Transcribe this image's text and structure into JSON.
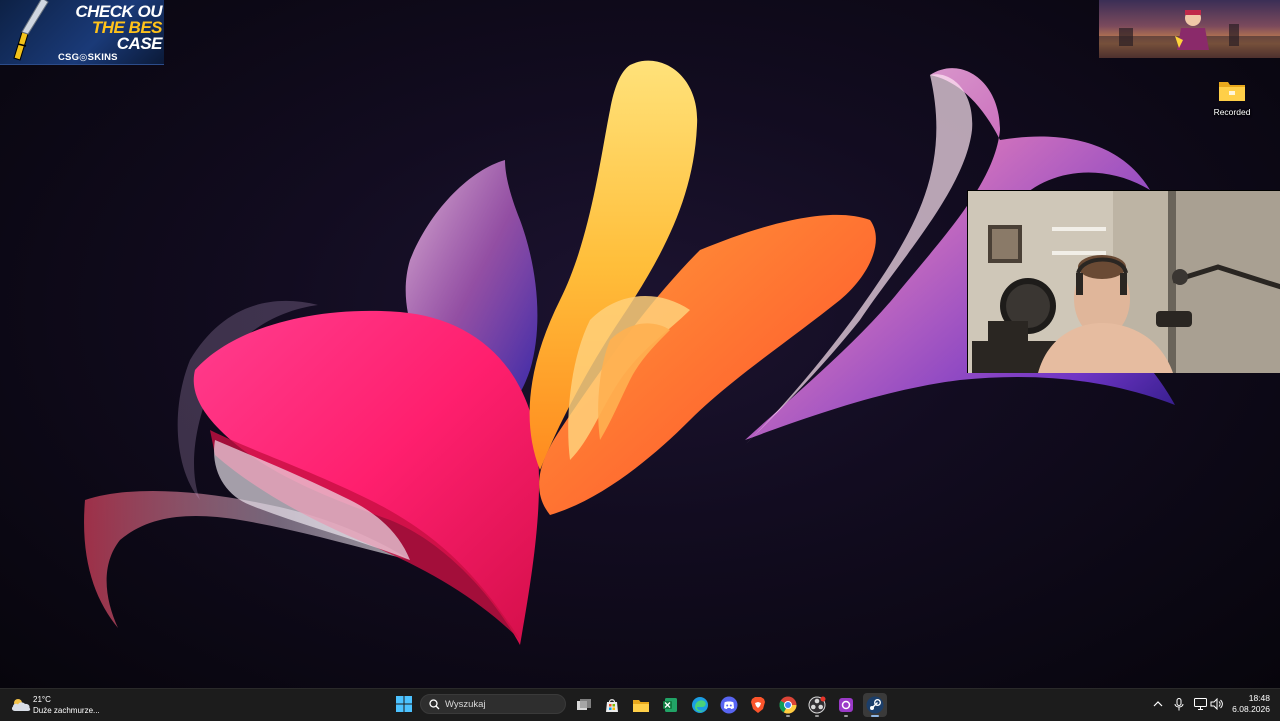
{
  "overlays": {
    "promo": {
      "line1": "CHECK OU",
      "line2": "THE BES",
      "line3": "CASE",
      "brand": "CSG◎SKINS"
    }
  },
  "desktop": {
    "icons": [
      {
        "label": "Recorded",
        "icon": "folder-icon"
      }
    ]
  },
  "taskbar": {
    "weather": {
      "temp": "21°C",
      "description": "Duże zachmurze..."
    },
    "search": {
      "placeholder": "Wyszukaj"
    },
    "apps": [
      {
        "name": "task-view",
        "icon": "task-view-icon"
      },
      {
        "name": "microsoft-store",
        "icon": "store-icon"
      },
      {
        "name": "file-explorer",
        "icon": "folder-icon"
      },
      {
        "name": "excel",
        "icon": "excel-icon"
      },
      {
        "name": "edge",
        "icon": "edge-icon"
      },
      {
        "name": "discord",
        "icon": "discord-icon"
      },
      {
        "name": "brave",
        "icon": "brave-icon"
      },
      {
        "name": "chrome",
        "icon": "chrome-icon"
      },
      {
        "name": "obs",
        "icon": "obs-icon"
      },
      {
        "name": "twitch-app",
        "icon": "app-icon"
      },
      {
        "name": "steam",
        "icon": "steam-icon"
      }
    ],
    "tray": {
      "icons": [
        "chevron-up-icon",
        "microphone-icon",
        "network-icon",
        "volume-icon"
      ]
    },
    "clock": {
      "time": "18:48",
      "date": "6.08.2026"
    }
  },
  "colors": {
    "taskbar": "#1c1c1c",
    "accent": "#8fb8e8",
    "promo_yellow": "#ffc21a"
  }
}
